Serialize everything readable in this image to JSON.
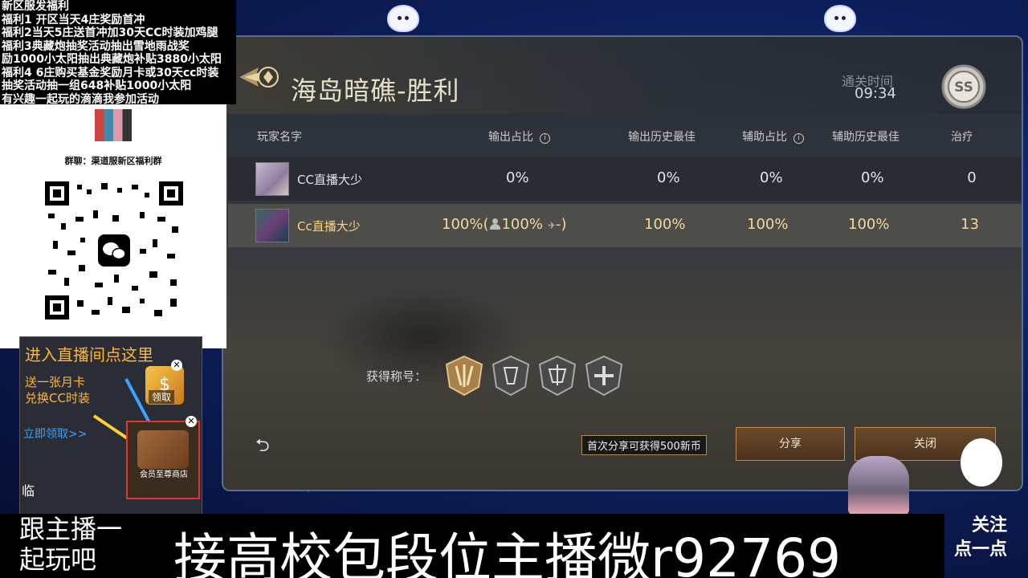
{
  "promo": {
    "lines": [
      "新区服发福利",
      "福利1 开区当天4庄奖励首冲",
      "福利2当天5庄送首冲加30天CC时装加鸡腿",
      "福利3典藏炮抽奖活动抽出雪地雨战奖",
      "励1000小太阳抽出典藏炮补贴3880小太阳",
      "福利4 6庄购买基金奖励月卡或30天cc时装",
      "抽奖活动抽一组648补贴1000小太阳",
      "有兴趣一起玩的滴滴我参加活动"
    ],
    "group_label": "群聊：渠道服新区福利群"
  },
  "live_panel": {
    "title": "进入直播间点这里",
    "promo_lines": [
      "送一张月卡",
      "兑换CC时装"
    ],
    "claim_link": "立即领取>>",
    "reward_label": "领取",
    "reward_glyph": "$",
    "shop_label": "会员至尊商店",
    "edge_text": "临",
    "close_glyph": "✕"
  },
  "game": {
    "mission_title": "海岛暗礁-胜利",
    "clear_time_label": "通关时间",
    "clear_time": "09:34",
    "rank": "SS",
    "columns": [
      "玩家名字",
      "输出占比",
      "输出历史最佳",
      "辅助占比",
      "辅助历史最佳",
      "治疗"
    ],
    "players": [
      {
        "name": "CC直播大少",
        "dmg_ratio": "0%",
        "dmg_best": "0%",
        "assist_ratio": "0%",
        "assist_best": "0%",
        "heal": "0"
      },
      {
        "name": "Cc直播大少",
        "dmg_ratio": "100%(",
        "dmg_sub": "100%",
        "dmg_tail": "-)",
        "dmg_best": "100%",
        "assist_ratio": "100%",
        "assist_best": "100%",
        "heal": "13"
      }
    ],
    "titles_label": "获得称号：",
    "share_tip": "首次分享可获得500新币",
    "share_button": "分享",
    "close_button": "关闭",
    "back_glyph": "⮌",
    "info_glyph": "i",
    "wing_glyph": "✈"
  },
  "bottom": {
    "side_text_line1": "跟主播一",
    "side_text_line2": "起玩吧",
    "banner": "接高校包段位主播微r92769",
    "follow_line1": "关注",
    "follow_line2": "点一点"
  }
}
